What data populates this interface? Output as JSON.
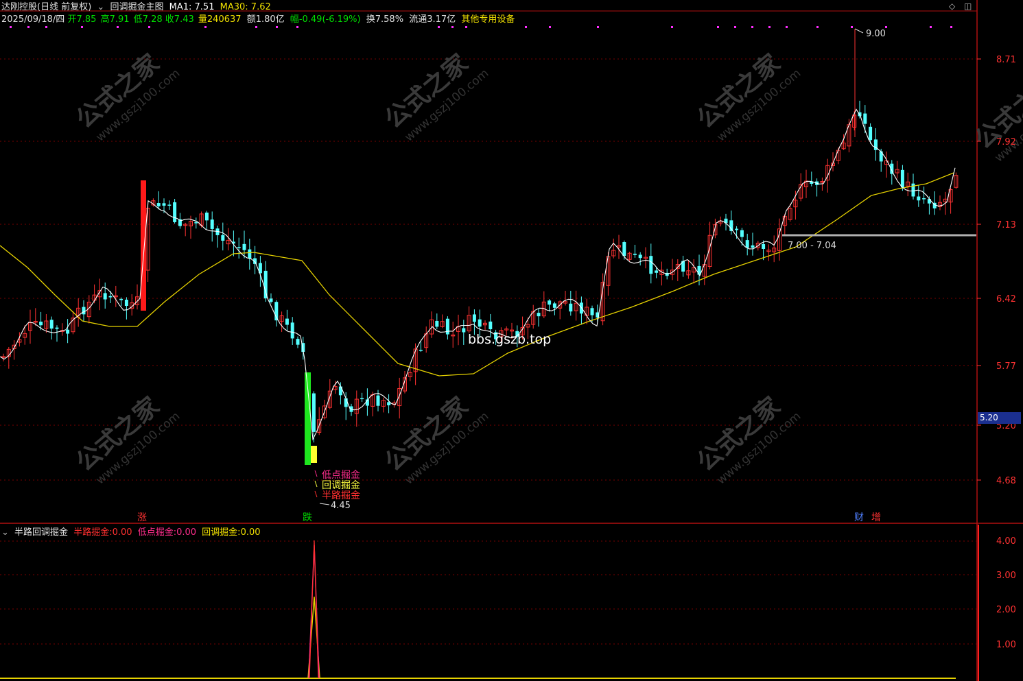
{
  "header": {
    "stock": "达刚控股(日线 前复权)",
    "indicator": "回调掘金主图",
    "ma1_label": "MA1:",
    "ma1": "7.51",
    "ma30_label": "MA30:",
    "ma30": "7.62"
  },
  "quote": {
    "date": "2025/09/18/四",
    "open_label": "开",
    "open": "7.85",
    "high_label": "高",
    "high": "7.91",
    "low_label": "低",
    "low": "7.28",
    "close_label": "收",
    "close": "7.43",
    "vol_label": "量",
    "vol": "240637",
    "amt_label": "额",
    "amt": "1.80亿",
    "chg_label": "幅",
    "chg": "-0.49(-6.19%)",
    "turn_label": "换",
    "turn": "7.58%",
    "float_label": "流通",
    "float": "3.17亿",
    "sector": "其他专用设备"
  },
  "price_axis": [
    "8.71",
    "7.92",
    "7.13",
    "6.42",
    "5.77",
    "5.20",
    "4.68"
  ],
  "current_price": "5.20",
  "annotations": {
    "high": "9.00",
    "low": "4.45",
    "support": "7.00 - 7.04",
    "watermark_url": "bbs.gszb.top",
    "watermark_cn": "公式之家",
    "watermark_site": "www.gszj100.com",
    "signal_low": "低点掘金",
    "signal_pullback": "回调掘金",
    "signal_half": "半路掘金",
    "mark_up": "涨",
    "mark_down": "跌",
    "mark_fin": "财",
    "mark_add": "增"
  },
  "sub_panel": {
    "title": "半路回调掘金",
    "v1_label": "半路掘金:",
    "v1": "0.00",
    "v2_label": "低点掘金:",
    "v2": "0.00",
    "v3_label": "回调掘金:",
    "v3": "0.00",
    "axis": [
      "4.00",
      "3.00",
      "2.00",
      "1.00"
    ]
  },
  "colors": {
    "up": "#ff3232",
    "down": "#54ffff",
    "ma1": "#ffffff",
    "ma30": "#e6d200",
    "grid": "#7a0000",
    "axis": "#ff3232",
    "label_yellow": "#f0e000",
    "label_green": "#00e000",
    "magenta": "#ff2dff"
  }
}
